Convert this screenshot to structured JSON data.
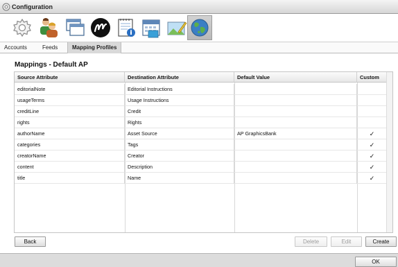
{
  "window": {
    "title": "Configuration"
  },
  "toolbar": {
    "buttons": [
      {
        "name": "settings-gear-tool",
        "icon": "gear-icon"
      },
      {
        "name": "users-tool",
        "icon": "users-icon"
      },
      {
        "name": "windows-tool",
        "icon": "windows-icon"
      },
      {
        "name": "m-logo-tool",
        "icon": "m-logo-icon"
      },
      {
        "name": "notepad-info-tool",
        "icon": "notepad-info-icon"
      },
      {
        "name": "calendar-tool",
        "icon": "calendar-icon"
      },
      {
        "name": "image-edit-tool",
        "icon": "image-edit-icon"
      },
      {
        "name": "globe-tool",
        "icon": "globe-icon",
        "active": true
      }
    ]
  },
  "tabs": [
    "Accounts",
    "Feeds",
    "Mapping Profiles"
  ],
  "page": {
    "heading": "Mappings - Default AP"
  },
  "table": {
    "columns": [
      "Source Attribute",
      "Destination Attribute",
      "Default Value",
      "Custom"
    ],
    "rows": [
      {
        "source": "editorialNote",
        "destination": "Editorial Instructions",
        "default": "",
        "custom": ""
      },
      {
        "source": "usageTerms",
        "destination": "Usage Instructions",
        "default": "",
        "custom": ""
      },
      {
        "source": "creditLine",
        "destination": "Credit",
        "default": "",
        "custom": ""
      },
      {
        "source": "rights",
        "destination": "Rights",
        "default": "",
        "custom": ""
      },
      {
        "source": "authorName",
        "destination": "Asset Source",
        "default": "AP GraphicsBank",
        "custom": "✓"
      },
      {
        "source": "categories",
        "destination": "Tags",
        "default": "",
        "custom": "✓"
      },
      {
        "source": "creatorName",
        "destination": "Creator",
        "default": "",
        "custom": "✓"
      },
      {
        "source": "content",
        "destination": "Description",
        "default": "",
        "custom": "✓"
      },
      {
        "source": "title",
        "destination": "Name",
        "default": "",
        "custom": "✓"
      }
    ]
  },
  "buttons": {
    "back": "Back",
    "delete": "Delete",
    "edit": "Edit",
    "create": "Create",
    "ok": "OK"
  },
  "colors": {
    "checkmark": "#222222",
    "active_tool": "#c4c4c4",
    "footer": "#dcdcdc"
  }
}
